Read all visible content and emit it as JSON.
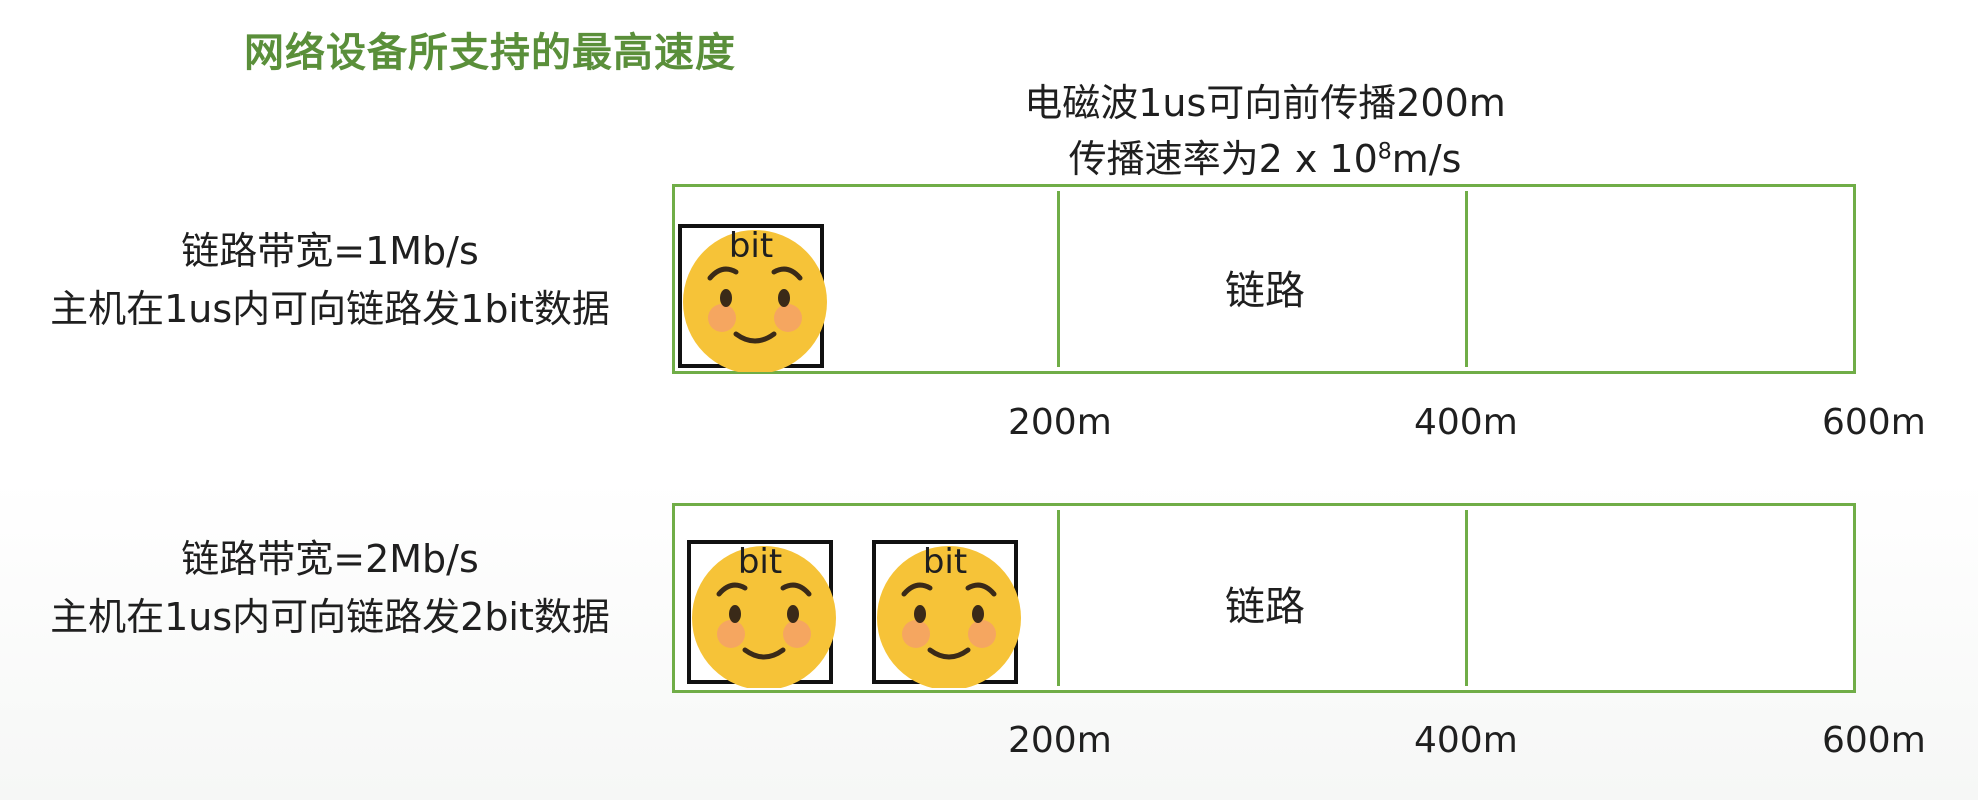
{
  "title": "网络设备所支持的最高速度",
  "note": {
    "line1": "电磁波1us可向前传播200m",
    "line2_prefix": "传播速率为2 x 10",
    "line2_exp": "8",
    "line2_suffix": "m/s"
  },
  "rows": [
    {
      "bandwidth": "链路带宽=1Mb/s",
      "desc": "主机在1us内可向链路发1bit数据",
      "link_label": "链路",
      "bits": [
        "bit"
      ],
      "distances": [
        "200m",
        "400m",
        "600m"
      ]
    },
    {
      "bandwidth": "链路带宽=2Mb/s",
      "desc": "主机在1us内可向链路发2bit数据",
      "link_label": "链路",
      "bits": [
        "bit",
        "bit"
      ],
      "distances": [
        "200m",
        "400m",
        "600m"
      ]
    }
  ],
  "colors": {
    "title": "#5a8f3a",
    "link_border": "#70ad47",
    "emoji_face": "#f6c338"
  },
  "icons": {
    "bit": "smiling-face-icon"
  }
}
